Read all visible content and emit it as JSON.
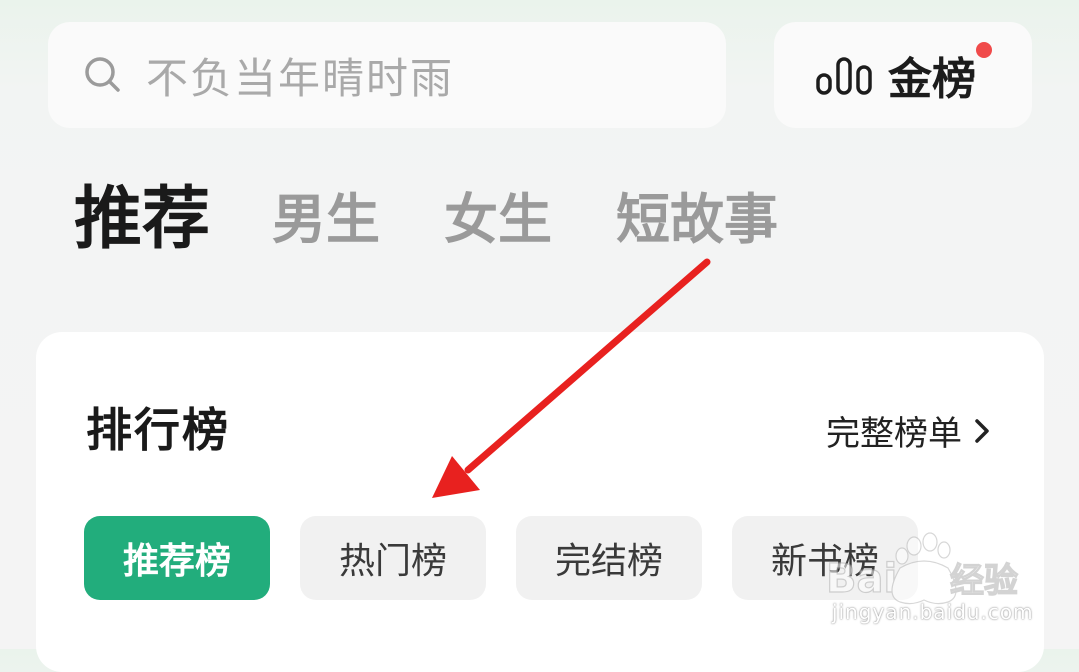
{
  "search": {
    "placeholder": "不负当年晴时雨"
  },
  "rank_button": {
    "label": "金榜",
    "icon": "bar-chart-icon",
    "has_notification": true
  },
  "tabs": [
    {
      "label": "推荐",
      "active": true
    },
    {
      "label": "男生",
      "active": false
    },
    {
      "label": "女生",
      "active": false
    },
    {
      "label": "短故事",
      "active": false
    }
  ],
  "ranking": {
    "title": "排行榜",
    "full_list_label": "完整榜单",
    "chips": [
      {
        "label": "推荐榜",
        "active": true
      },
      {
        "label": "热门榜",
        "active": false
      },
      {
        "label": "完结榜",
        "active": false
      },
      {
        "label": "新书榜",
        "active": false
      }
    ]
  },
  "colors": {
    "accent": "#22ad7c",
    "notify": "#f04a4a",
    "annotation": "#e8211f"
  },
  "watermark": {
    "brand": "Baidu经验",
    "url": "jingyan.baidu.com"
  }
}
